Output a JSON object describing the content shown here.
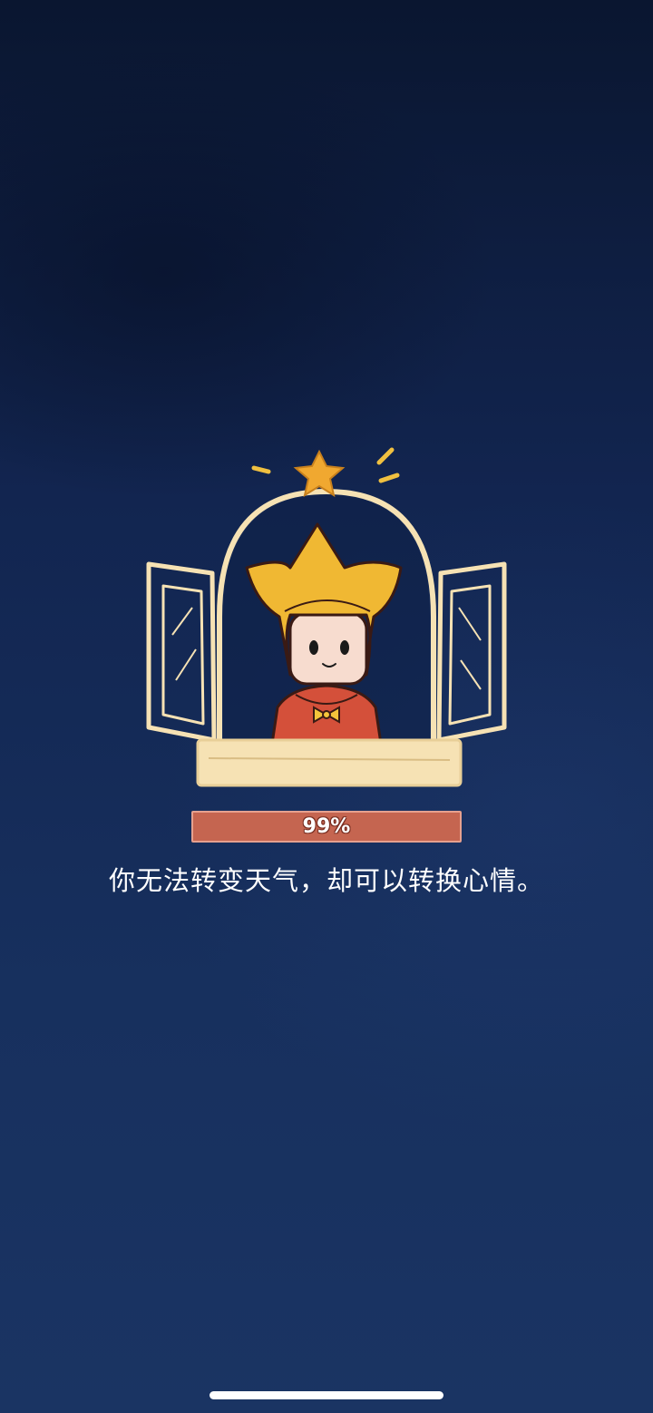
{
  "loading": {
    "progress_percent": 99,
    "progress_label": "99%",
    "tip": "你无法转变天气，却可以转换心情。"
  },
  "illustration": {
    "subject": "crown-hat-character-at-window"
  },
  "colors": {
    "background_top": "#0a1630",
    "background_bottom": "#1a3463",
    "progress_bar": "#c56550",
    "window_frame": "#f6e2b4",
    "crown": "#f0b833",
    "cloak": "#d4503a"
  }
}
